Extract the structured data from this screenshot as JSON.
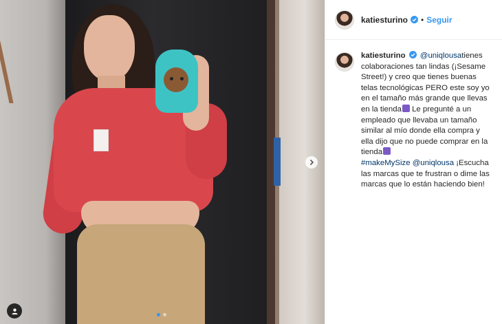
{
  "header": {
    "username": "katiesturino",
    "separator": "•",
    "follow_label": "Seguir",
    "verified_icon": "verified-badge-icon"
  },
  "caption": {
    "username": "katiesturino",
    "mention1": "@uniqlousa",
    "text1": "tienes colaboraciones tan lindas (¡Sesame Street!) y creo que tienes buenas telas tecnológicas PERO este soy yo en el tamaño más grande que llevas en la tienda",
    "text2": " Le pregunté a un empleado que llevaba un tamaño similar al mío donde ella compra y ella dijo que no puede comprar en la tienda",
    "hashtag": "#makeMySize",
    "mention2": "@uniqlousa",
    "text3": " ¡Escucha las marcas que te frustran o dime las marcas que lo están haciendo bien!"
  },
  "carousel": {
    "current": 1,
    "total": 2
  },
  "colors": {
    "link": "#003569",
    "follow": "#3897f0",
    "active_dot": "#3a97f0"
  }
}
